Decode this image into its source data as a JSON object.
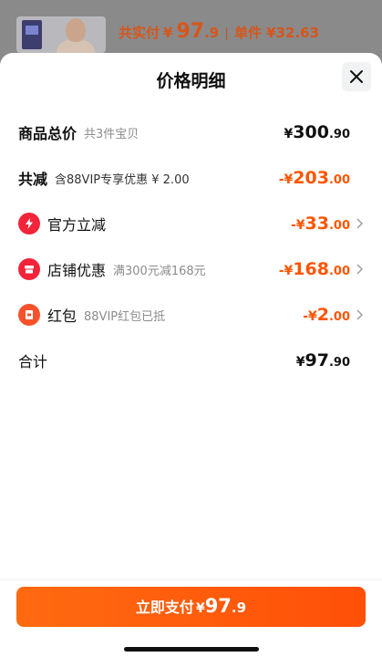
{
  "summary": {
    "label": "共实付",
    "currency": "¥",
    "int": "97",
    "dec": ".9",
    "separator": "|",
    "unit_price": "单件 ¥32.63"
  },
  "sheet": {
    "title": "价格明细"
  },
  "rows": {
    "goods_total": {
      "name": "商品总价",
      "note": "共3件宝贝",
      "cur": "¥",
      "int": "300",
      "dec": ".90"
    },
    "total_discount": {
      "name": "共减",
      "note": "含88VIP专享优惠 ¥ 2.00",
      "cur": "-¥",
      "int": "203",
      "dec": ".00"
    },
    "official": {
      "name": "官方立减",
      "note": "",
      "cur": "-¥",
      "int": "33",
      "dec": ".00"
    },
    "store": {
      "name": "店铺优惠",
      "note": "满300元减168元",
      "cur": "-¥",
      "int": "168",
      "dec": ".00"
    },
    "redpacket": {
      "name": "红包",
      "note": "88VIP红包已抵",
      "cur": "-¥",
      "int": "2",
      "dec": ".00"
    },
    "total": {
      "name": "合计",
      "cur": "¥",
      "int": "97",
      "dec": ".90"
    }
  },
  "pay_button": {
    "label": "立即支付",
    "cur": "¥",
    "int": "97",
    "dec": ".9"
  },
  "icons": {
    "close": "close-icon",
    "official": "lightning-icon",
    "store": "store-icon",
    "redpacket": "red-packet-icon",
    "chevron": "chevron-right-icon"
  },
  "colors": {
    "accent": "#ff5500",
    "summary_text": "#d6561b",
    "icon_red": "#f2243a",
    "icon_orange": "#f5522b",
    "button": "#ff6a10"
  }
}
